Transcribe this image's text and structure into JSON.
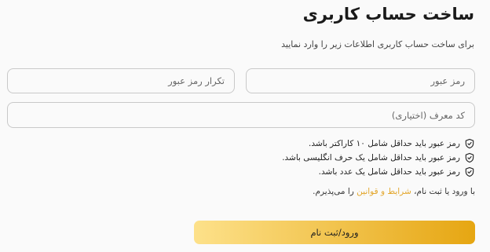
{
  "header": {
    "title": "ساخت حساب کاربری",
    "subtitle": "برای ساخت حساب کاربری اطلاعات زیر را وارد نمایید"
  },
  "form": {
    "password_placeholder": "رمز عبور",
    "confirm_password_placeholder": "تکرار رمز عبور",
    "referral_placeholder": "کد معرف (اختیاری)"
  },
  "rules": [
    {
      "text": "رمز عبور باید حداقل شامل ۱۰ کاراکتر باشد.",
      "icon": "shield-check-icon"
    },
    {
      "text": "رمز عبور باید حداقل شامل یک حرف انگلیسی باشد.",
      "icon": "shield-check-icon"
    },
    {
      "text": "رمز عبور باید حداقل شامل یک عدد باشد.",
      "icon": "shield-check-icon"
    }
  ],
  "terms": {
    "prefix": "با ورود یا ثبت نام، ",
    "link": "شرایط و قوانین",
    "suffix": " را می‌پذیرم."
  },
  "submit_label": "ورود/ثبت نام",
  "colors": {
    "accent": "#e3a72d",
    "button_gradient_start": "#e6a612",
    "button_gradient_end": "#fde18a"
  }
}
